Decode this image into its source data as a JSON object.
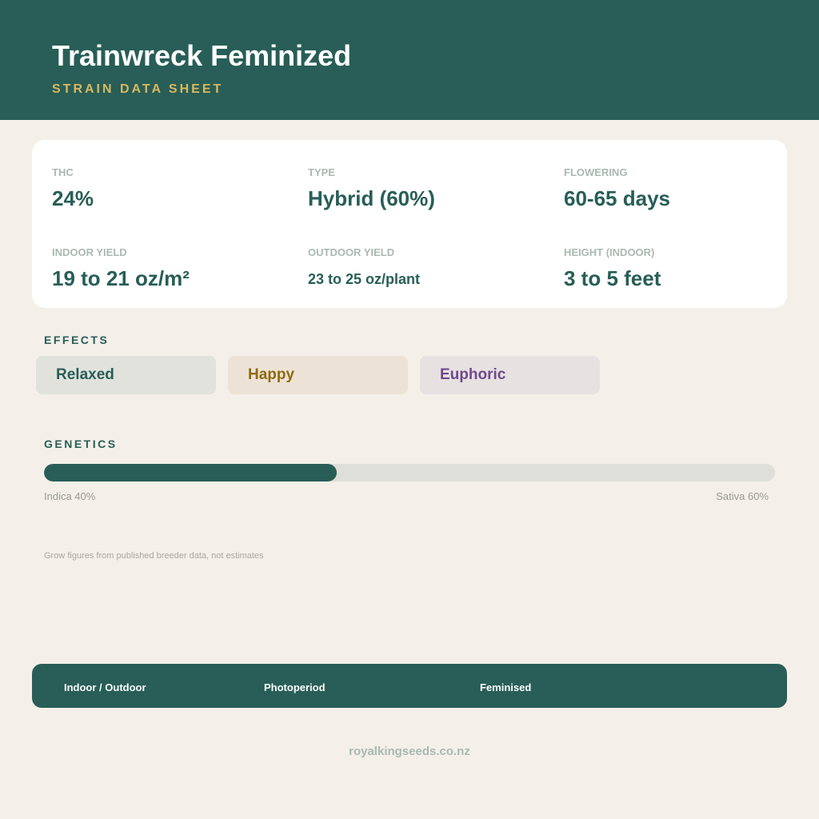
{
  "header": {
    "title": "Trainwreck Feminized",
    "subtitle": "STRAIN DATA SHEET"
  },
  "stats": [
    {
      "label": "THC",
      "value": "24%"
    },
    {
      "label": "TYPE",
      "value": "Hybrid (60%)"
    },
    {
      "label": "FLOWERING",
      "value": "60-65 days"
    },
    {
      "label": "INDOOR YIELD",
      "value": "19 to 21 oz/m²"
    },
    {
      "label": "OUTDOOR YIELD",
      "value": "23 to 25 oz/plant"
    },
    {
      "label": "HEIGHT (INDOOR)",
      "value": "3 to 5 feet"
    }
  ],
  "effects": {
    "title": "EFFECTS",
    "items": [
      {
        "label": "Relaxed",
        "text_color": "#285e57",
        "bg_color": "#e1e2dc"
      },
      {
        "label": "Happy",
        "text_color": "#8f6a12",
        "bg_color": "#ece3d6"
      },
      {
        "label": "Euphoric",
        "text_color": "#6e4a8c",
        "bg_color": "#e7e1e2"
      }
    ]
  },
  "genetics": {
    "title": "GENETICS",
    "indica_label": "Indica 40%",
    "sativa_label": "Sativa 60%",
    "indica_fraction": 0.4
  },
  "footnote": "Grow figures from published breeder data, not estimates",
  "footer": {
    "items": [
      "Indoor / Outdoor",
      "Photoperiod",
      "Feminised"
    ]
  },
  "site_url": "royalkingseeds.co.nz",
  "colors": {
    "primary": "#285e57",
    "accent": "#d8b85f",
    "background": "#f4efe9"
  }
}
